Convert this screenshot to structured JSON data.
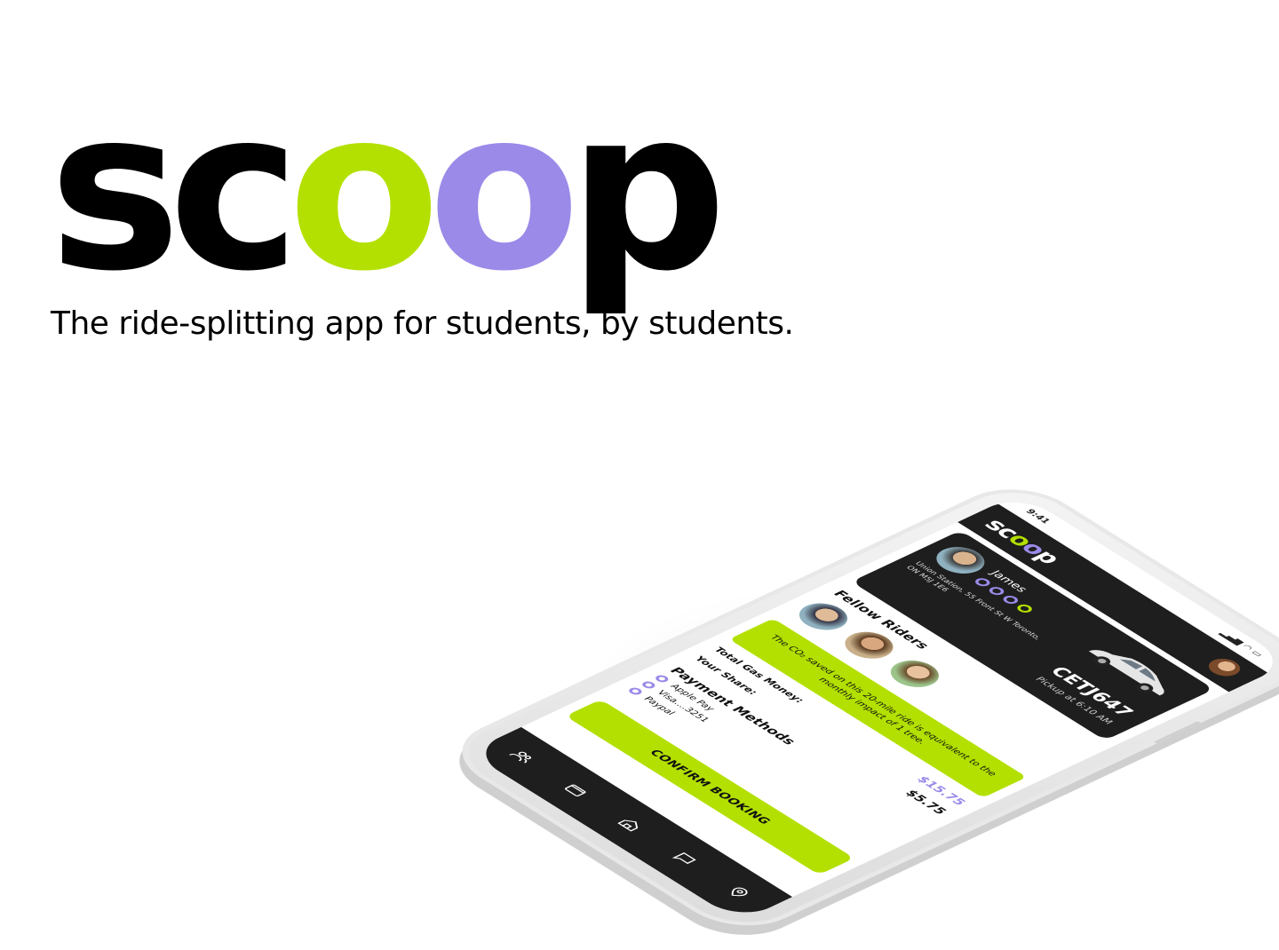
{
  "brand": {
    "logo_letters": [
      "s",
      "c",
      "o",
      "o",
      "p"
    ],
    "logo_colors": [
      "#000000",
      "#000000",
      "#b3e000",
      "#9b8ae8",
      "#000000"
    ],
    "tagline": "The ride-splitting app for students, by students."
  },
  "phone": {
    "status_time": "9:41",
    "header": {
      "logo_text": "scoop"
    },
    "driver": {
      "name": "James",
      "rating_dots": 4,
      "address": "Union Station, 55 Front St W Toronto, ON M5J 1E6",
      "plate": "CETJ647",
      "pickup": "Pickup at 6:10 AM"
    },
    "fellow_riders": {
      "title": "Fellow Riders",
      "count": 3
    },
    "co2_note": "The CO₂ saved on this 20-mile ride is equivalent to the monthly impact of 1 tree.",
    "costs": {
      "total_label": "Total Gas Money:",
      "total_value": "$15.75",
      "share_label": "Your Share:",
      "share_value": "$5.75"
    },
    "payment": {
      "title": "Payment Methods",
      "methods": [
        "Apple Pay",
        "Visa....3251",
        "Paypal"
      ]
    },
    "confirm_label": "CONFIRM BOOKING",
    "tabs": [
      "people-icon",
      "wallet-icon",
      "home-icon",
      "chat-icon",
      "location-icon"
    ]
  },
  "colors": {
    "accent_green": "#b3e000",
    "accent_purple": "#9b8ae8",
    "dark": "#1e1e1e"
  }
}
